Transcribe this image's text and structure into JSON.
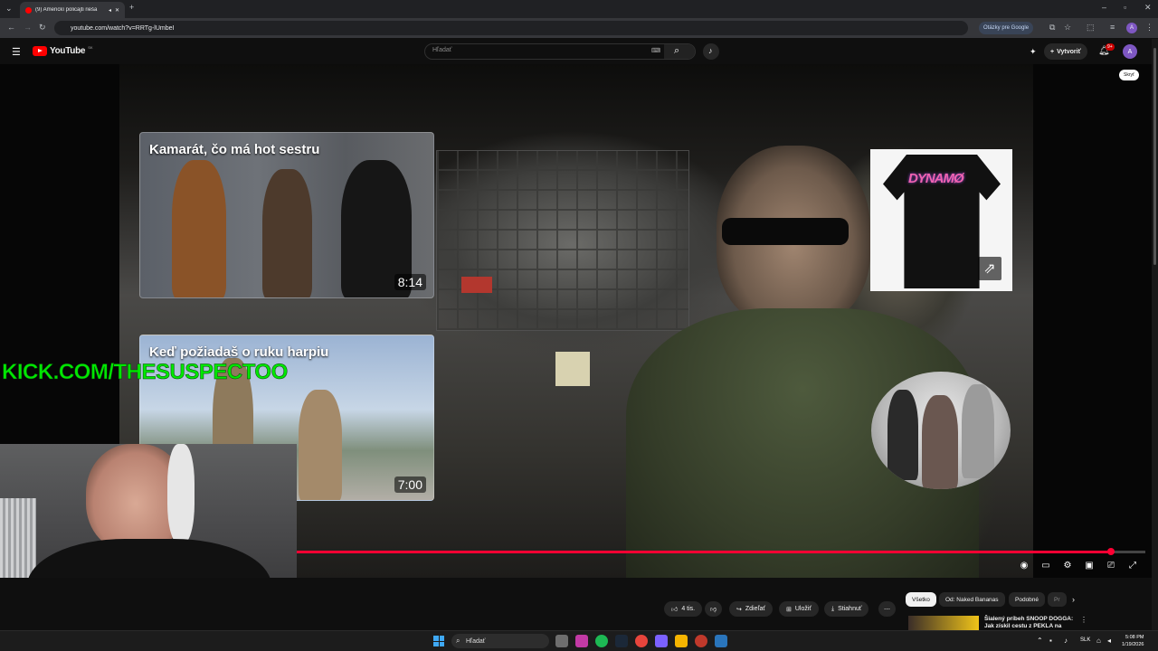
{
  "browser": {
    "tab_title": "(9) Americkí policajti rieša",
    "url": "youtube.com/watch?v=RRTg-lUmbeI",
    "google_questions_label": "Otázky pre Google",
    "profile_letter": "A"
  },
  "youtube": {
    "logo_text": "YouTube",
    "region_code": "SK",
    "search_placeholder": "Hľadať",
    "create_label": "Vytvoriť",
    "notif_count": "9+",
    "avatar_letter": "A"
  },
  "player": {
    "hide_label": "Skryť",
    "progress_fraction": 0.96,
    "endcards": [
      {
        "title": "Kamarát, čo má hot sestru",
        "duration": "8:14"
      },
      {
        "title": "Keď požiadaš o ruku harpiu",
        "duration": "7:00"
      }
    ]
  },
  "overlay": {
    "kick_url": "KICK.COM/THESUSPECTOO"
  },
  "actions": {
    "like_count": "4 tis.",
    "share_label": "Zdieľať",
    "save_label": "Uložiť",
    "download_label": "Stiahnuť"
  },
  "chips": [
    "Všetko",
    "Od: Naked Bananas",
    "Podobné",
    "Pr"
  ],
  "recommendation": {
    "title": "Šialený príbeh SNOOP DOGGA: Jak získil cestu z PEKLA na"
  },
  "taskbar": {
    "search_label": "Hľadať",
    "lang": "SLK",
    "time": "5:08 PM",
    "date": "1/19/2026"
  }
}
